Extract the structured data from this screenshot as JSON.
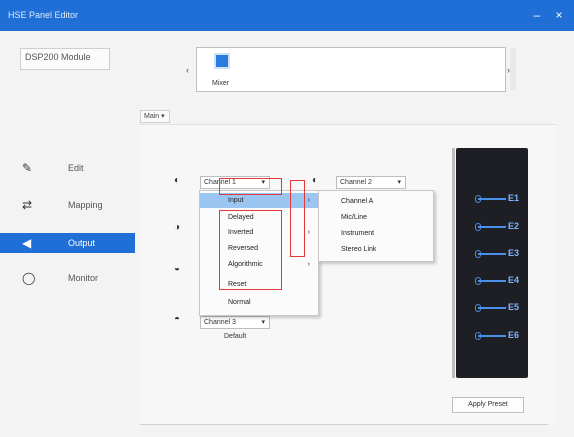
{
  "window": {
    "title": "HSE Panel Editor",
    "min_label": "–",
    "close_label": "×"
  },
  "device": {
    "name": "DSP200 Module"
  },
  "files": {
    "left_arrow": "‹",
    "right_arrow": "›",
    "item_label": "Mixer"
  },
  "tab": {
    "label": "Main ▾"
  },
  "nav": [
    {
      "icon": "✎",
      "label": "Edit"
    },
    {
      "icon": "⇄",
      "label": "Mapping"
    },
    {
      "icon": "◀",
      "label": "Output"
    },
    {
      "icon": "◯",
      "label": "Monitor"
    }
  ],
  "rows": {
    "r1_icon": "◐",
    "r2_icon": "◑",
    "r3_icon": "◒",
    "r4_icon": "◓",
    "dd1": "Channel 1",
    "dd2": "Channel 2",
    "dd3": "Channel 3",
    "caret": "▾",
    "below_label": "Default"
  },
  "menu1": [
    {
      "label": "Input",
      "has_sub": true,
      "highlighted": true
    },
    {
      "label": "Delayed",
      "has_sub": false,
      "highlighted": false
    },
    {
      "label": "Inverted",
      "has_sub": true,
      "highlighted": false
    },
    {
      "label": "Reversed",
      "has_sub": false,
      "highlighted": false
    },
    {
      "label": "Algorithmic",
      "has_sub": true,
      "highlighted": false
    },
    {
      "label": "Reset",
      "has_sub": false,
      "highlighted": false
    },
    {
      "label": "Normal",
      "has_sub": false,
      "highlighted": false
    }
  ],
  "menu2": [
    "Channel A",
    "Mic/Line",
    "Instrument",
    "Stereo Link"
  ],
  "sub_arrow": "›",
  "ports": [
    "E1",
    "E2",
    "E3",
    "E4",
    "E5",
    "E6"
  ],
  "apply_button": "Apply Preset",
  "colors": {
    "accent": "#1f6fd6",
    "highlight": "#9cc6f2",
    "annotation_red": "#e03a3a",
    "panel_bg": "#1d1f24",
    "port_blue": "#4a8fe8"
  }
}
